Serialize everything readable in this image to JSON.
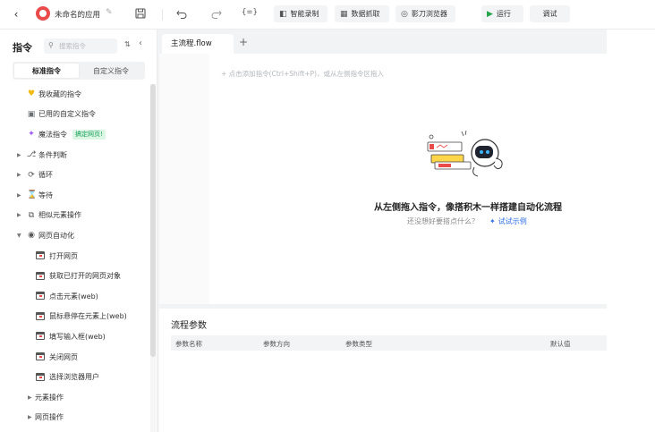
{
  "toolbar": {
    "app_name": "未命名的应用",
    "variables_label": "{=}",
    "record_label": "智能录制",
    "scrape_label": "数据抓取",
    "browser_label": "影刀浏览器",
    "run_label": "运行",
    "debug_label": "调试"
  },
  "sidebar": {
    "title": "指令",
    "search_placeholder": "搜索指令",
    "tabs": [
      {
        "label": "标准指令",
        "active": true
      },
      {
        "label": "自定义指令",
        "active": false
      }
    ],
    "items": [
      {
        "label": "我收藏的指令",
        "icon": "heart-icon"
      },
      {
        "label": "已用的自定义指令",
        "icon": "bag-icon"
      },
      {
        "label": "魔法指令",
        "icon": "sparkle-icon",
        "tag": "搞定网页!"
      },
      {
        "label": "条件判断",
        "icon": "branch-icon"
      },
      {
        "label": "循环",
        "icon": "loop-icon"
      },
      {
        "label": "等待",
        "icon": "hourglass-icon"
      },
      {
        "label": "相似元素操作",
        "icon": "copy-icon"
      },
      {
        "label": "网页自动化",
        "icon": "globe-icon",
        "expanded": true
      },
      {
        "label": "打开网页",
        "icon": "webpage-icon"
      },
      {
        "label": "获取已打开的网页对象",
        "icon": "webpage-icon"
      },
      {
        "label": "点击元素(web)",
        "icon": "webpage-icon"
      },
      {
        "label": "鼠标悬停在元素上(web)",
        "icon": "webpage-icon"
      },
      {
        "label": "填写输入框(web)",
        "icon": "webpage-icon"
      },
      {
        "label": "关闭网页",
        "icon": "webpage-icon"
      },
      {
        "label": "选择浏览器用户",
        "icon": "webpage-icon"
      },
      {
        "label": "元素操作",
        "icon": ""
      },
      {
        "label": "网页操作",
        "icon": ""
      }
    ]
  },
  "editor": {
    "tab_label": "主流程.flow",
    "add_tab": "+",
    "hint": "+ 点击添加指令(Ctrl+Shift+P)，或从左侧指令区拖入",
    "empty_title": "从左侧拖入指令，像搭积木一样搭建自动化流程",
    "empty_subtitle": "还没想好要搭点什么？",
    "try_link": "试试示例"
  },
  "params": {
    "title": "流程参数",
    "columns": [
      "参数名称",
      "参数方向",
      "参数类型",
      "默认值"
    ]
  },
  "colors": {
    "accent": "#2f6fe8",
    "run_green": "#22a34a",
    "magic_tag_bg": "#dcf6e4",
    "magic_tag_text": "#18a058",
    "logo_red": "#e94b4b"
  }
}
